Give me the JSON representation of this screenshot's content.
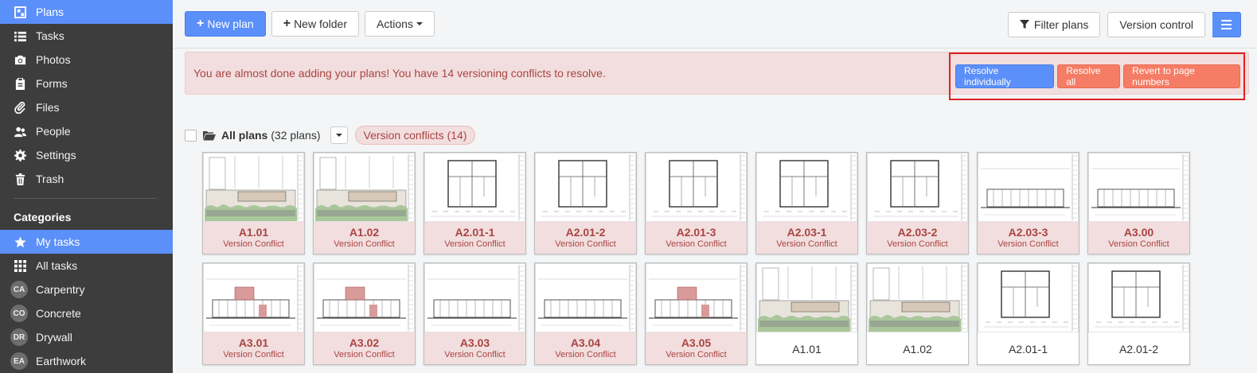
{
  "sidebar": {
    "nav": [
      {
        "label": "Plans",
        "icon": "plans-icon",
        "active": true
      },
      {
        "label": "Tasks",
        "icon": "list-icon",
        "active": false
      },
      {
        "label": "Photos",
        "icon": "camera-icon",
        "active": false
      },
      {
        "label": "Forms",
        "icon": "clipboard-icon",
        "active": false
      },
      {
        "label": "Files",
        "icon": "paperclip-icon",
        "active": false
      },
      {
        "label": "People",
        "icon": "people-icon",
        "active": false
      },
      {
        "label": "Settings",
        "icon": "gear-icon",
        "active": false
      },
      {
        "label": "Trash",
        "icon": "trash-icon",
        "active": false
      }
    ],
    "categories_title": "Categories",
    "categories": [
      {
        "label": "My tasks",
        "icon": "star-icon",
        "active": true
      },
      {
        "label": "All tasks",
        "icon": "grid-dots-icon",
        "active": false
      },
      {
        "label": "Carpentry",
        "badge": "CA"
      },
      {
        "label": "Concrete",
        "badge": "CO"
      },
      {
        "label": "Drywall",
        "badge": "DR"
      },
      {
        "label": "Earthwork",
        "badge": "EA"
      }
    ]
  },
  "toolbar": {
    "new_plan": "New plan",
    "new_folder": "New folder",
    "actions": "Actions",
    "filter_plans": "Filter plans",
    "version_control": "Version control"
  },
  "alert": {
    "message": "You are almost done adding your plans! You have 14 versioning conflicts to resolve.",
    "resolve_individually": "Resolve individually",
    "resolve_all": "Resolve all",
    "revert": "Revert to page numbers"
  },
  "plans_header": {
    "title": "All plans",
    "count": "(32 plans)",
    "conflicts_pill": "Version conflicts (14)"
  },
  "colors": {
    "accent": "#5b8ff9",
    "conflict_bg": "#f2dede",
    "conflict_text": "#a94442",
    "danger_button": "#f57c65",
    "sidebar_bg": "#3d3d3d"
  },
  "plans": [
    {
      "name": "A1.01",
      "status": "Version Conflict",
      "thumb": "site"
    },
    {
      "name": "A1.02",
      "status": "Version Conflict",
      "thumb": "site"
    },
    {
      "name": "A2.01-1",
      "status": "Version Conflict",
      "thumb": "floor"
    },
    {
      "name": "A2.01-2",
      "status": "Version Conflict",
      "thumb": "floor"
    },
    {
      "name": "A2.01-3",
      "status": "Version Conflict",
      "thumb": "floor"
    },
    {
      "name": "A2.03-1",
      "status": "Version Conflict",
      "thumb": "floor"
    },
    {
      "name": "A2.03-2",
      "status": "Version Conflict",
      "thumb": "floor"
    },
    {
      "name": "A2.03-3",
      "status": "Version Conflict",
      "thumb": "elev"
    },
    {
      "name": "A3.00",
      "status": "Version Conflict",
      "thumb": "elev"
    },
    {
      "name": "A3.01",
      "status": "Version Conflict",
      "thumb": "elevred"
    },
    {
      "name": "A3.02",
      "status": "Version Conflict",
      "thumb": "elevred"
    },
    {
      "name": "A3.03",
      "status": "Version Conflict",
      "thumb": "elev"
    },
    {
      "name": "A3.04",
      "status": "Version Conflict",
      "thumb": "elev"
    },
    {
      "name": "A3.05",
      "status": "Version Conflict",
      "thumb": "elevred"
    },
    {
      "name": "A1.01",
      "status": "",
      "thumb": "site"
    },
    {
      "name": "A1.02",
      "status": "",
      "thumb": "site"
    },
    {
      "name": "A2.01-1",
      "status": "",
      "thumb": "floor"
    },
    {
      "name": "A2.01-2",
      "status": "",
      "thumb": "floor"
    }
  ]
}
